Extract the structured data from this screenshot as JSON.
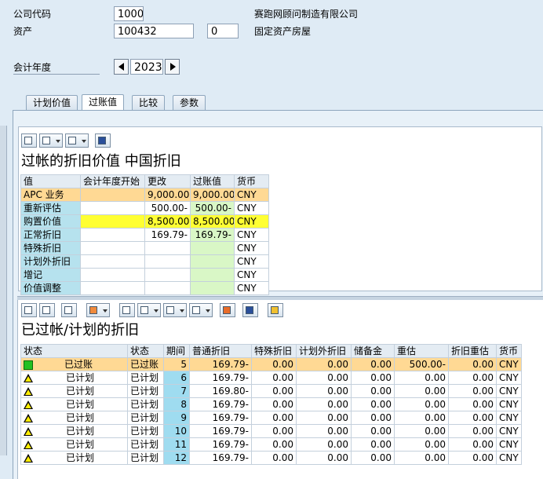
{
  "header": {
    "company_code_label": "公司代码",
    "company_code_value": "1000",
    "company_name": "赛跑网顾问制造有限公司",
    "asset_label": "资产",
    "asset_value": "100432",
    "sub_asset_value": "0",
    "asset_description": "固定资产房屋",
    "fiscal_year_label": "会计年度",
    "fiscal_year_value": "2023"
  },
  "tabs": [
    "计划价值",
    "过账值",
    "比较",
    "参数"
  ],
  "section1": {
    "title": "过帐的折旧价值 中国折旧",
    "columns": [
      "值",
      "会计年度开始",
      "更改",
      "过账值",
      "货币"
    ],
    "rows": [
      {
        "label": "APC 业务",
        "start": "",
        "change": "9,000.00",
        "posted": "9,000.00",
        "currency": "CNY"
      },
      {
        "label": "重新评估",
        "start": "",
        "change": "500.00-",
        "posted": "500.00-",
        "currency": "CNY"
      },
      {
        "label": "购置价值",
        "start": "",
        "change": "8,500.00",
        "posted": "8,500.00",
        "currency": "CNY"
      },
      {
        "label": "正常折旧",
        "start": "",
        "change": "169.79-",
        "posted": "169.79-",
        "currency": "CNY"
      },
      {
        "label": "特殊折旧",
        "start": "",
        "change": "",
        "posted": "",
        "currency": "CNY"
      },
      {
        "label": "计划外折旧",
        "start": "",
        "change": "",
        "posted": "",
        "currency": "CNY"
      },
      {
        "label": "增记",
        "start": "",
        "change": "",
        "posted": "",
        "currency": "CNY"
      },
      {
        "label": "价值调整",
        "start": "",
        "change": "",
        "posted": "",
        "currency": "CNY"
      }
    ]
  },
  "section2": {
    "title": "已过帐/计划的折旧",
    "columns": [
      "状态",
      "状态",
      "期间",
      "普通折旧",
      "特殊折旧",
      "计划外折旧",
      "储备金",
      "重估",
      "折旧重估",
      "货币"
    ],
    "rows": [
      {
        "status_icon": "green-square",
        "status1": "已过账",
        "status2": "已过账",
        "period": "5",
        "ordinary": "169.79-",
        "special": "0.00",
        "unplanned": "0.00",
        "reserve": "0.00",
        "revaluation": "500.00-",
        "reval_dep": "0.00",
        "currency": "CNY"
      },
      {
        "status_icon": "warning-triangle",
        "status1": "已计划",
        "status2": "已计划",
        "period": "6",
        "ordinary": "169.79-",
        "special": "0.00",
        "unplanned": "0.00",
        "reserve": "0.00",
        "revaluation": "0.00",
        "reval_dep": "0.00",
        "currency": "CNY"
      },
      {
        "status_icon": "warning-triangle",
        "status1": "已计划",
        "status2": "已计划",
        "period": "7",
        "ordinary": "169.80-",
        "special": "0.00",
        "unplanned": "0.00",
        "reserve": "0.00",
        "revaluation": "0.00",
        "reval_dep": "0.00",
        "currency": "CNY"
      },
      {
        "status_icon": "warning-triangle",
        "status1": "已计划",
        "status2": "已计划",
        "period": "8",
        "ordinary": "169.79-",
        "special": "0.00",
        "unplanned": "0.00",
        "reserve": "0.00",
        "revaluation": "0.00",
        "reval_dep": "0.00",
        "currency": "CNY"
      },
      {
        "status_icon": "warning-triangle",
        "status1": "已计划",
        "status2": "已计划",
        "period": "9",
        "ordinary": "169.79-",
        "special": "0.00",
        "unplanned": "0.00",
        "reserve": "0.00",
        "revaluation": "0.00",
        "reval_dep": "0.00",
        "currency": "CNY"
      },
      {
        "status_icon": "warning-triangle",
        "status1": "已计划",
        "status2": "已计划",
        "period": "10",
        "ordinary": "169.79-",
        "special": "0.00",
        "unplanned": "0.00",
        "reserve": "0.00",
        "revaluation": "0.00",
        "reval_dep": "0.00",
        "currency": "CNY"
      },
      {
        "status_icon": "warning-triangle",
        "status1": "已计划",
        "status2": "已计划",
        "period": "11",
        "ordinary": "169.79-",
        "special": "0.00",
        "unplanned": "0.00",
        "reserve": "0.00",
        "revaluation": "0.00",
        "reval_dep": "0.00",
        "currency": "CNY"
      },
      {
        "status_icon": "warning-triangle",
        "status1": "已计划",
        "status2": "已计划",
        "period": "12",
        "ordinary": "169.79-",
        "special": "0.00",
        "unplanned": "0.00",
        "reserve": "0.00",
        "revaluation": "0.00",
        "reval_dep": "0.00",
        "currency": "CNY"
      }
    ]
  },
  "colors": {
    "posted_row": "#ffd994",
    "yellow": "#ffff33",
    "green": "#d9f7c6",
    "row_header": "#b6e2ee"
  }
}
